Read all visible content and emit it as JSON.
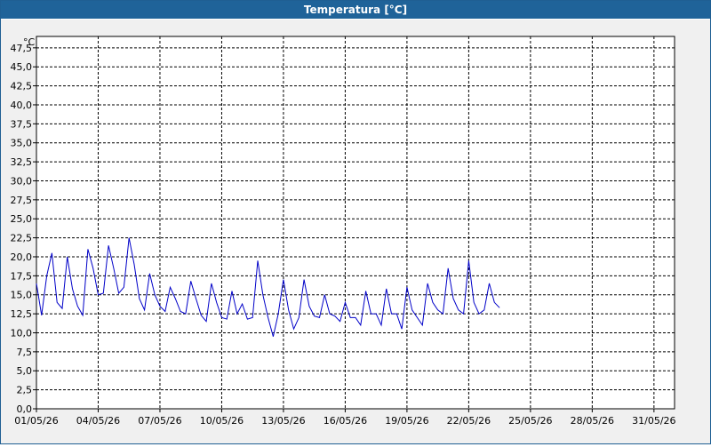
{
  "window": {
    "title": "Temperatura [°C]"
  },
  "chart_data": {
    "type": "line",
    "title": "Temperatura [°C]",
    "ylabel": "°C",
    "ylim": [
      0,
      49
    ],
    "xlim": [
      "01/05/26",
      "01/06/26"
    ],
    "yticks": [
      "0,0",
      "2,5",
      "5,0",
      "7,5",
      "10,0",
      "12,5",
      "15,0",
      "17,5",
      "20,0",
      "22,5",
      "25,0",
      "27,5",
      "30,0",
      "32,5",
      "35,0",
      "37,5",
      "40,0",
      "42,5",
      "45,0",
      "47,5"
    ],
    "xticks": [
      "01/05/26",
      "04/05/26",
      "07/05/26",
      "10/05/26",
      "13/05/26",
      "16/05/26",
      "19/05/26",
      "22/05/26",
      "25/05/26",
      "28/05/26",
      "31/05/26"
    ],
    "grid": true,
    "line_color": "#0000c8",
    "series": [
      {
        "x": [
          "01/05/26 00:00",
          "01/05/26 06:00",
          "01/05/26 12:00",
          "01/05/26 18:00",
          "02/05/26 00:00",
          "02/05/26 06:00",
          "02/05/26 12:00",
          "02/05/26 18:00",
          "03/05/26 00:00",
          "03/05/26 06:00",
          "03/05/26 12:00",
          "03/05/26 18:00",
          "04/05/26 00:00",
          "04/05/26 06:00",
          "04/05/26 12:00",
          "04/05/26 18:00",
          "05/05/26 00:00",
          "05/05/26 06:00",
          "05/05/26 12:00",
          "05/05/26 18:00",
          "06/05/26 00:00",
          "06/05/26 06:00",
          "06/05/26 12:00",
          "06/05/26 18:00",
          "07/05/26 00:00",
          "07/05/26 06:00",
          "07/05/26 12:00",
          "07/05/26 18:00",
          "08/05/26 00:00",
          "08/05/26 06:00",
          "08/05/26 12:00",
          "08/05/26 18:00",
          "09/05/26 00:00",
          "09/05/26 06:00",
          "09/05/26 12:00",
          "09/05/26 18:00",
          "10/05/26 00:00",
          "10/05/26 06:00",
          "10/05/26 12:00",
          "10/05/26 18:00",
          "11/05/26 00:00",
          "11/05/26 06:00",
          "11/05/26 12:00",
          "11/05/26 18:00",
          "12/05/26 00:00",
          "12/05/26 06:00",
          "12/05/26 12:00",
          "12/05/26 18:00",
          "13/05/26 00:00",
          "13/05/26 06:00",
          "13/05/26 12:00",
          "13/05/26 18:00",
          "14/05/26 00:00",
          "14/05/26 06:00",
          "14/05/26 12:00",
          "14/05/26 18:00",
          "15/05/26 00:00",
          "15/05/26 06:00",
          "15/05/26 12:00",
          "15/05/26 18:00",
          "16/05/26 00:00",
          "16/05/26 06:00",
          "16/05/26 12:00",
          "16/05/26 18:00",
          "17/05/26 00:00",
          "17/05/26 06:00",
          "17/05/26 12:00",
          "17/05/26 18:00",
          "18/05/26 00:00",
          "18/05/26 06:00",
          "18/05/26 12:00",
          "18/05/26 18:00",
          "19/05/26 00:00",
          "19/05/26 06:00",
          "19/05/26 12:00",
          "19/05/26 18:00",
          "20/05/26 00:00",
          "20/05/26 06:00",
          "20/05/26 12:00",
          "20/05/26 18:00",
          "21/05/26 00:00",
          "21/05/26 06:00",
          "21/05/26 12:00",
          "21/05/26 18:00",
          "22/05/26 00:00",
          "22/05/26 06:00",
          "22/05/26 12:00",
          "22/05/26 18:00",
          "23/05/26 00:00",
          "23/05/26 06:00",
          "23/05/26 12:00"
        ],
        "values": [
          16.5,
          12.3,
          17.5,
          20.5,
          14.0,
          13.2,
          20.0,
          15.8,
          13.5,
          12.3,
          21.0,
          18.5,
          15.0,
          15.2,
          21.5,
          18.5,
          15.2,
          16.0,
          22.5,
          19.0,
          14.5,
          13.0,
          17.8,
          15.0,
          13.5,
          12.8,
          16.0,
          14.5,
          12.8,
          12.5,
          16.8,
          14.5,
          12.3,
          11.5,
          16.5,
          14.0,
          12.0,
          11.8,
          15.5,
          12.5,
          13.8,
          11.8,
          12.0,
          19.5,
          15.0,
          12.0,
          9.5,
          12.5,
          17.0,
          13.0,
          10.5,
          12.0,
          17.0,
          13.5,
          12.2,
          12.0,
          15.0,
          12.5,
          12.2,
          11.5,
          14.0,
          12.0,
          12.0,
          11.0,
          15.5,
          12.5,
          12.5,
          11.0,
          15.8,
          12.5,
          12.5,
          10.5,
          16.0,
          13.0,
          12.0,
          11.0,
          16.5,
          14.0,
          13.0,
          12.5,
          18.5,
          14.5,
          13.0,
          12.5,
          19.5,
          14.0,
          12.5,
          13.0,
          16.5,
          14.0,
          13.3
        ]
      }
    ]
  }
}
